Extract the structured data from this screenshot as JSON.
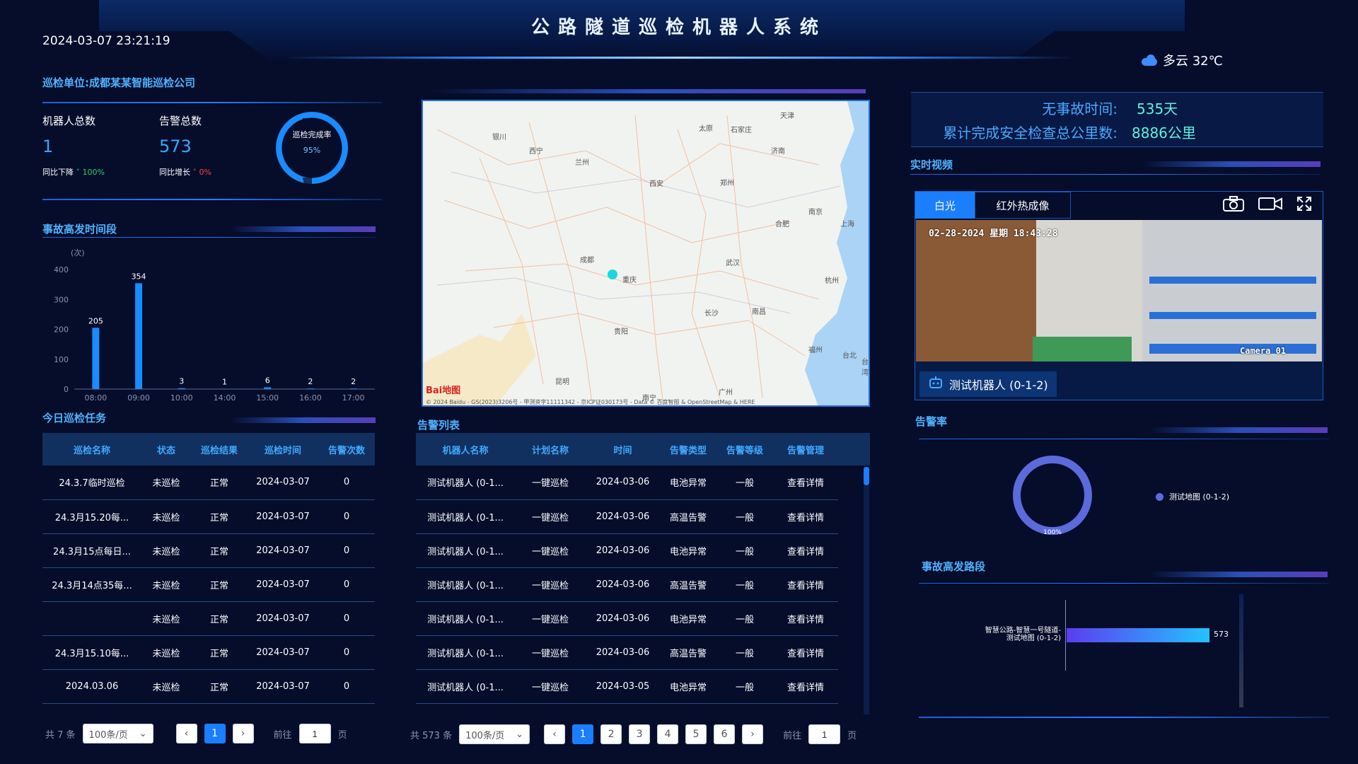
{
  "header": {
    "title": "公路隧道巡检机器人系统",
    "datetime": "2024-03-07 23:21:19",
    "weather": "多云 32℃"
  },
  "left": {
    "unit_title": "巡检单位:成都某某智能巡检公司",
    "robots_label": "机器人总数",
    "robots_value": "1",
    "robots_trend_label": "同比下降",
    "robots_trend_value": "100%",
    "alarms_label": "告警总数",
    "alarms_value": "573",
    "alarms_trend_label": "同比增长",
    "alarms_trend_value": "0%",
    "ring_label": "巡检完成率",
    "ring_value": "95%",
    "ring_fraction": 0.95,
    "accident_title": "事故高发时间段",
    "today_title": "今日巡检任务",
    "task_headers": [
      "巡检名称",
      "状态",
      "巡检结果",
      "巡检时间",
      "告警次数"
    ],
    "tasks": [
      [
        "24.3.7临时巡检",
        "未巡检",
        "正常",
        "2024-03-07",
        "0"
      ],
      [
        "24.3月15.20每...",
        "未巡检",
        "正常",
        "2024-03-07",
        "0"
      ],
      [
        "24.3月15点每日...",
        "未巡检",
        "正常",
        "2024-03-07",
        "0"
      ],
      [
        "24.3月14点35每...",
        "未巡检",
        "正常",
        "2024-03-07",
        "0"
      ],
      [
        "",
        "未巡检",
        "正常",
        "2024-03-07",
        "0"
      ],
      [
        "24.3月15.10每...",
        "未巡检",
        "正常",
        "2024-03-07",
        "0"
      ],
      [
        "2024.03.06",
        "未巡检",
        "正常",
        "2024-03-07",
        "0"
      ]
    ],
    "pager": {
      "total": "共 7 条",
      "size": "100条/页",
      "page": "1",
      "goto_label": "前往",
      "goto_value": "1",
      "goto_suffix": "页"
    }
  },
  "chart_data": {
    "type": "bar",
    "unit": "(次)",
    "categories": [
      "08:00",
      "09:00",
      "10:00",
      "14:00",
      "15:00",
      "16:00",
      "17:00"
    ],
    "values": [
      205,
      354,
      3,
      1,
      6,
      2,
      2
    ],
    "ylim": [
      0,
      400
    ],
    "yticks": [
      0,
      100,
      200,
      300,
      400
    ],
    "color": "#1a8cff"
  },
  "middle": {
    "map_copyright": "© 2024 Baidu - GS(2023)3206号 - 甲测资字11111342 - 京ICP证030173号 - Data © 百度智图 & OpenStreetMap & HERE",
    "map_logo": "Bai地图",
    "cities": [
      "天津",
      "太原",
      "石家庄",
      "济南",
      "银川",
      "西宁",
      "兰州",
      "郑州",
      "西安",
      "南京",
      "合肥",
      "上海",
      "成都",
      "武汉",
      "杭州",
      "重庆",
      "长沙",
      "南昌",
      "贵阳",
      "福州",
      "昆明",
      "台北",
      "南宁",
      "广州",
      "台湾"
    ],
    "alarm_title": "告警列表",
    "alarm_headers": [
      "机器人名称",
      "计划名称",
      "时间",
      "告警类型",
      "告警等级",
      "告警管理"
    ],
    "alarms": [
      [
        "测试机器人 (0-1...",
        "一键巡检",
        "2024-03-06",
        "电池异常",
        "一般",
        "查看详情"
      ],
      [
        "测试机器人 (0-1...",
        "一键巡检",
        "2024-03-06",
        "高温告警",
        "一般",
        "查看详情"
      ],
      [
        "测试机器人 (0-1...",
        "一键巡检",
        "2024-03-06",
        "电池异常",
        "一般",
        "查看详情"
      ],
      [
        "测试机器人 (0-1...",
        "一键巡检",
        "2024-03-06",
        "高温告警",
        "一般",
        "查看详情"
      ],
      [
        "测试机器人 (0-1...",
        "一键巡检",
        "2024-03-06",
        "电池异常",
        "一般",
        "查看详情"
      ],
      [
        "测试机器人 (0-1...",
        "一键巡检",
        "2024-03-06",
        "高温告警",
        "一般",
        "查看详情"
      ],
      [
        "测试机器人 (0-1...",
        "一键巡检",
        "2024-03-05",
        "电池异常",
        "一般",
        "查看详情"
      ]
    ],
    "pager": {
      "total": "共 573 条",
      "size": "100条/页",
      "pages": [
        "1",
        "2",
        "3",
        "4",
        "5",
        "6"
      ],
      "goto_label": "前往",
      "goto_value": "1",
      "goto_suffix": "页"
    }
  },
  "right": {
    "safe_label": "无事故时间:",
    "safe_value": "535天",
    "km_label": "累计完成安全检查总公里数:",
    "km_value": "8886公里",
    "video_title": "实时视频",
    "tab_white": "白光",
    "tab_ir": "红外热成像",
    "osd_time": "02-28-2024 星期 18:43:28",
    "osd_cam": "Camera 01",
    "robot_name": "测试机器人 (0-1-2)",
    "alarm_rate_title": "告警率",
    "alarm_rate_legend": "测试地图 (0-1-2)",
    "alarm_rate_value": "100%",
    "road_title": "事故高发路段",
    "road_label_1": "智慧公路-智慧一号隧道-",
    "road_label_2": "测试地图 (0-1-2)",
    "road_value": "573"
  }
}
